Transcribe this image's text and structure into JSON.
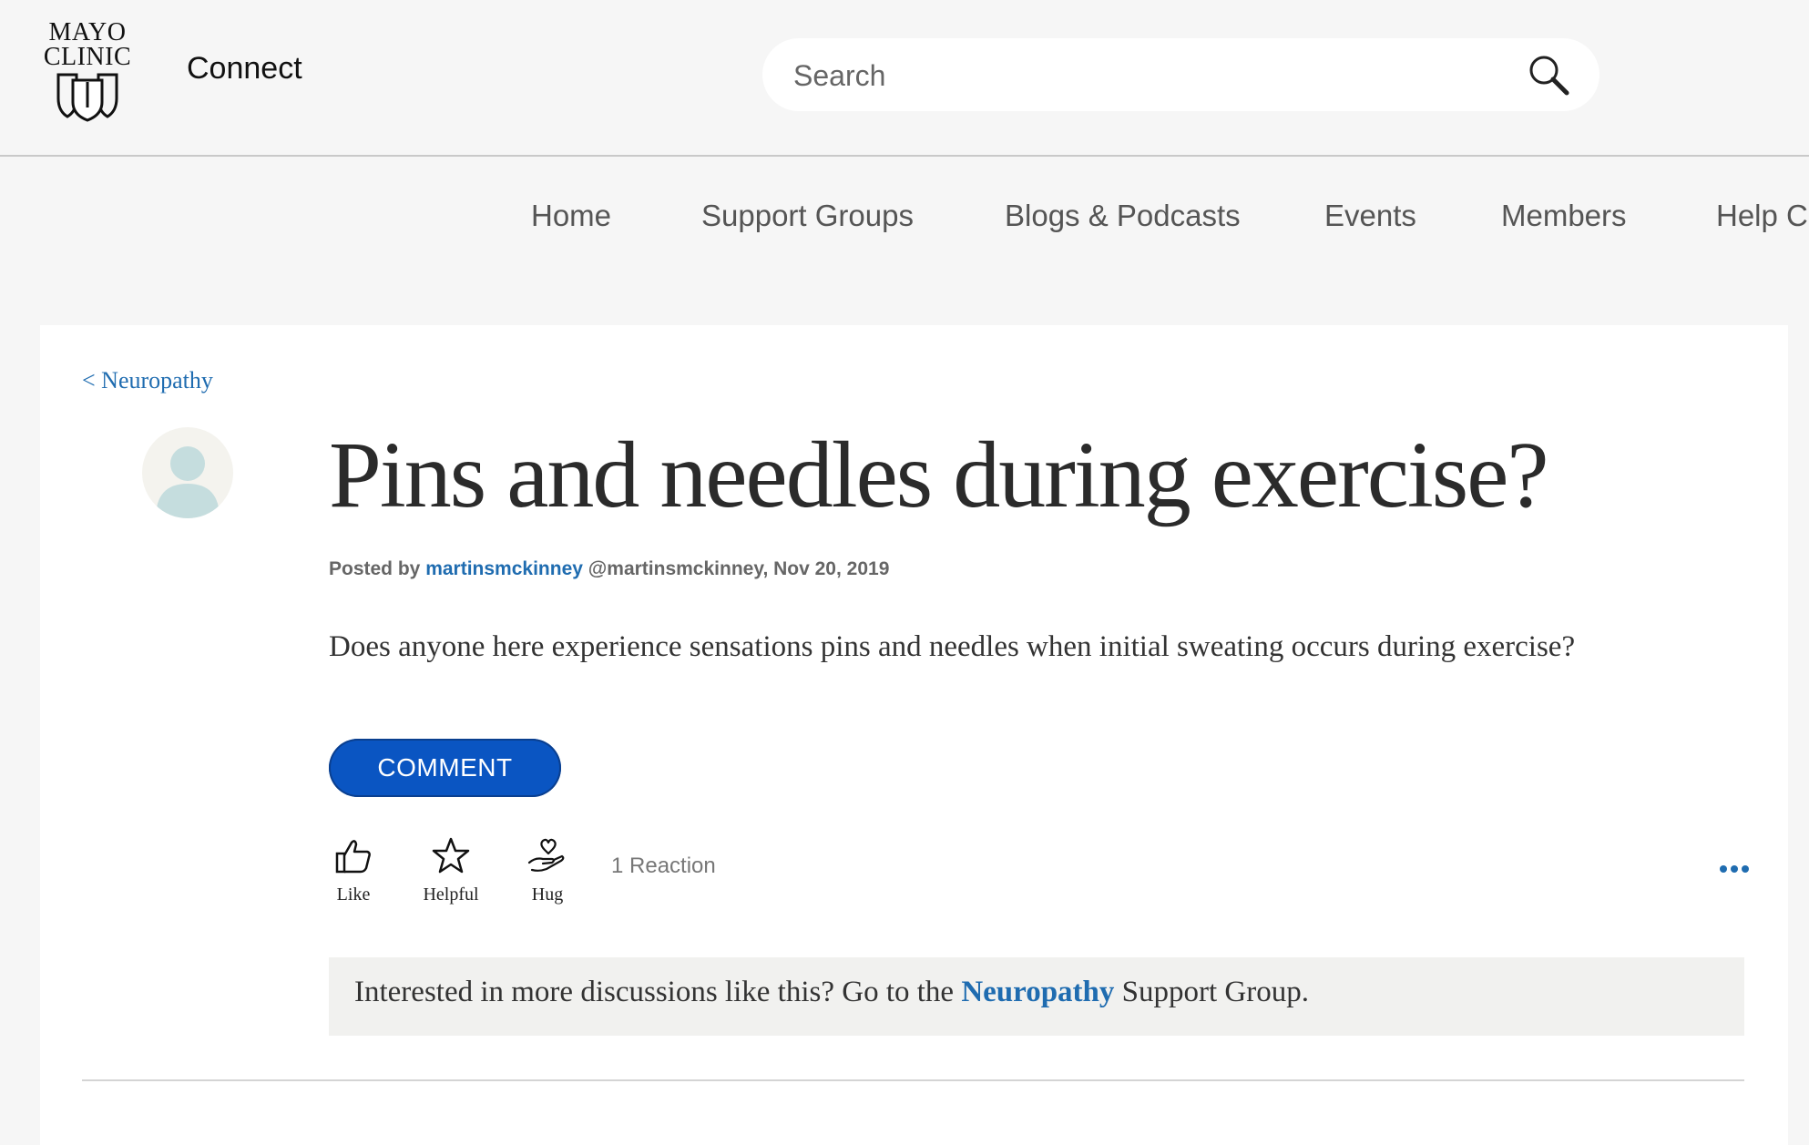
{
  "header": {
    "logo_line1": "MAYO",
    "logo_line2": "CLINIC",
    "app_name": "Connect",
    "search_placeholder": "Search"
  },
  "nav": {
    "items": [
      "Home",
      "Support Groups",
      "Blogs & Podcasts",
      "Events",
      "Members",
      "Help C"
    ]
  },
  "post": {
    "breadcrumb": "< Neuropathy",
    "title": "Pins and needles during exercise?",
    "posted_by_label": "Posted by",
    "author": "martinsmckinney",
    "handle_date": "@martinsmckinney, Nov 20, 2019",
    "body": "Does anyone here experience sensations pins and needles when initial sweating occurs during exercise?",
    "comment_label": "COMMENT",
    "reactions": [
      {
        "label": "Like",
        "icon": "thumbs-up-icon"
      },
      {
        "label": "Helpful",
        "icon": "star-icon"
      },
      {
        "label": "Hug",
        "icon": "hug-icon"
      }
    ],
    "reaction_count": "1 Reaction",
    "promo_prefix": "Interested in more discussions like this? Go to the",
    "promo_link": "Neuropathy",
    "promo_suffix": "Support Group."
  },
  "colors": {
    "link": "#1f6cb0",
    "button": "#0a55c2",
    "background": "#f6f6f6",
    "avatar": "#c5ddde"
  }
}
